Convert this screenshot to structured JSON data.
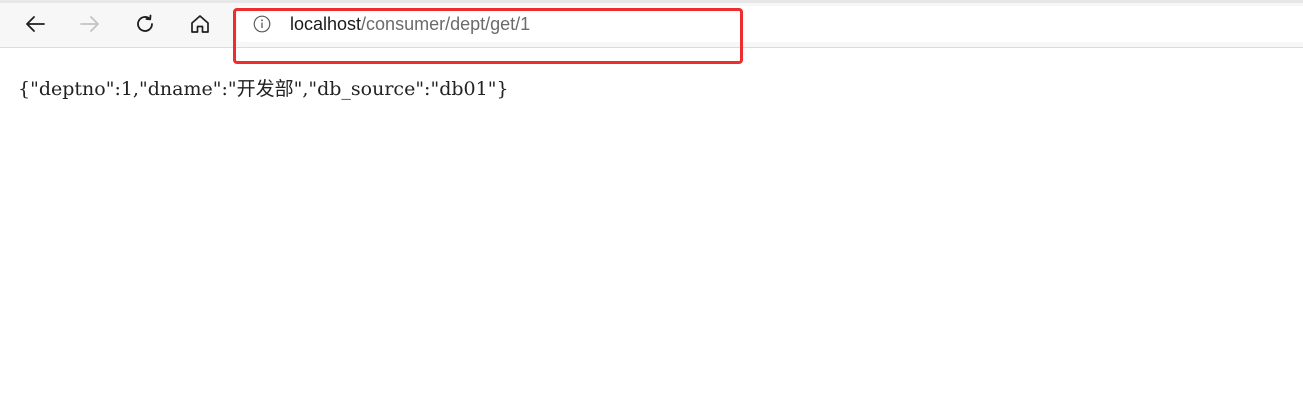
{
  "browser": {
    "nav": {
      "back_icon": "arrow-left-icon",
      "forward_icon": "arrow-right-icon",
      "refresh_icon": "refresh-icon",
      "home_icon": "home-icon"
    },
    "address_bar": {
      "info_icon": "info-icon",
      "url_host": "localhost",
      "url_path": "/consumer/dept/get/1"
    },
    "annotation_color": "#f02d2d"
  },
  "page": {
    "body_text": "{\"deptno\":1,\"dname\":\"开发部\",\"db_source\":\"db01\"}"
  }
}
